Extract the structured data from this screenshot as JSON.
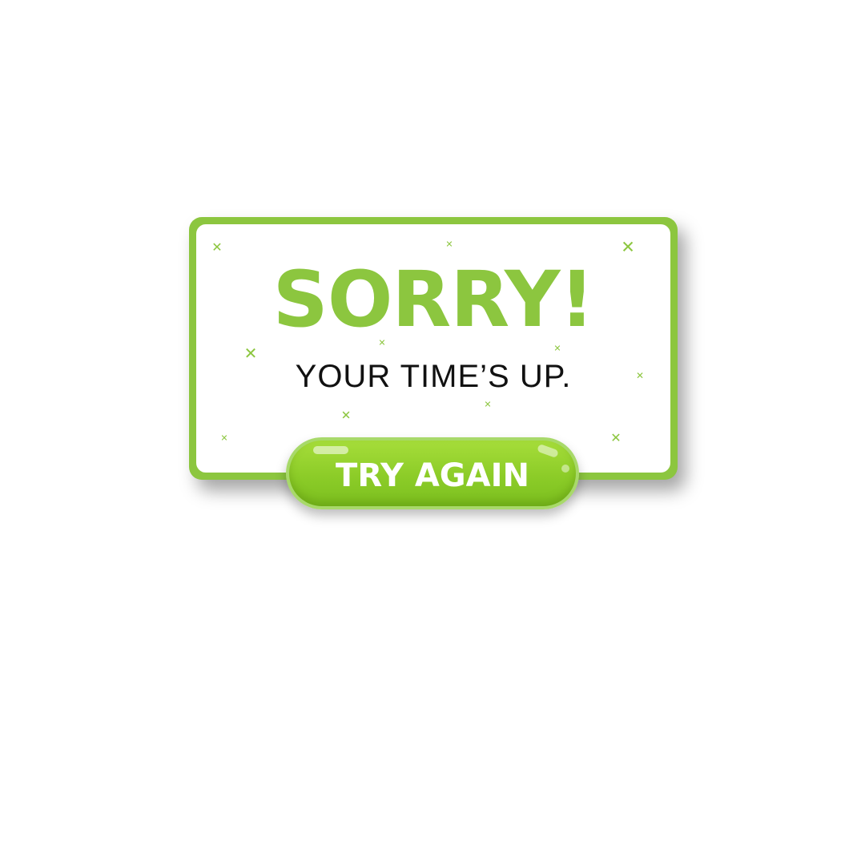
{
  "dialog": {
    "title": "SORRY!",
    "message": "YOUR TIME’S UP.",
    "button_label": "TRY AGAIN",
    "accent_color": "#8cc63f",
    "button_color": "#96d22f",
    "text_color": "#111111"
  },
  "decorations": {
    "icon": "cross-icon",
    "glyph": "✕"
  }
}
